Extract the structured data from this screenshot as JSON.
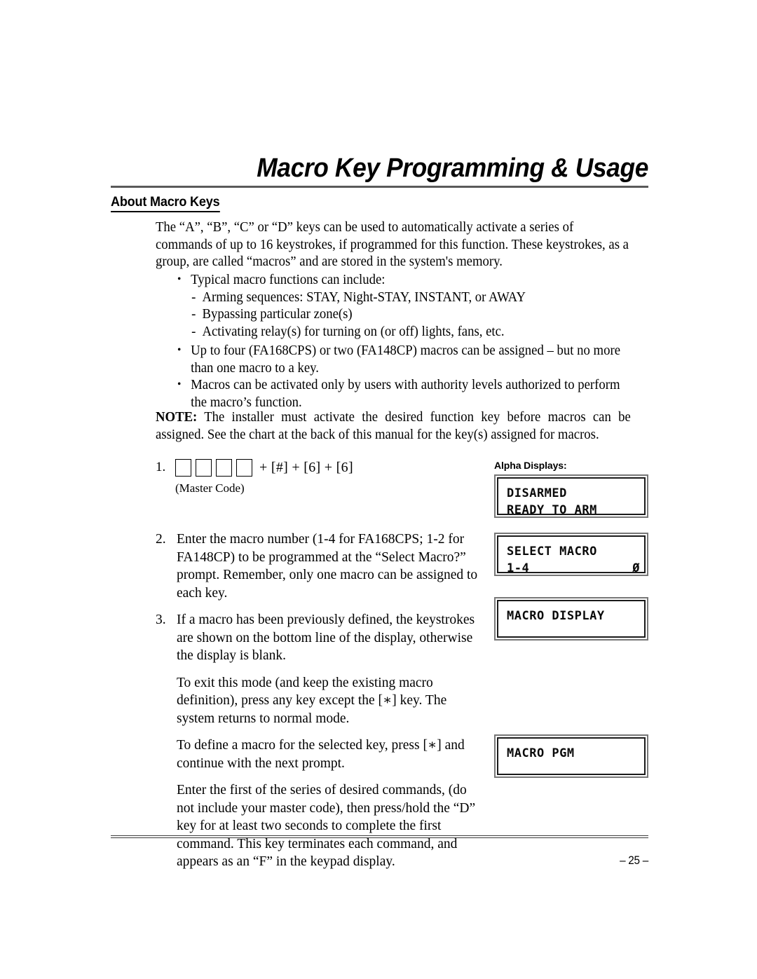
{
  "document": {
    "title": "Macro Key Programming & Usage",
    "section_heading": "About Macro Keys",
    "page_number": "– 25 –"
  },
  "intro": {
    "paragraph": "The “A”, “B”, “C” or “D” keys can be used to automatically activate a series of commands of up to 16 keystrokes, if programmed for this function. These keystrokes, as a group, are called “macros” and are stored in the system's memory."
  },
  "bullets": [
    {
      "type": "bullet",
      "text": "Typical macro functions can include:"
    },
    {
      "type": "dash",
      "text": "Arming sequences: STAY, Night-STAY, INSTANT, or AWAY"
    },
    {
      "type": "dash",
      "text": "Bypassing particular zone(s)"
    },
    {
      "type": "dash",
      "text": "Activating relay(s) for turning on (or off) lights, fans, etc."
    },
    {
      "type": "bullet",
      "text": "Up to four (FA168CPS) or two (FA148CP) macros can be assigned – but no more than one macro to a key."
    },
    {
      "type": "bullet",
      "text": "Macros can be activated only by users with authority levels authorized to perform the macro’s function."
    }
  ],
  "note": {
    "label": "NOTE:",
    "text": " The installer must activate the desired function key before macros can be assigned. See the chart at the back of this manual for the key(s) assigned for macros."
  },
  "step1": {
    "number": "1.",
    "box_count": 4,
    "keys": "+  [#] + [6] + [6]",
    "caption": "(Master Code)"
  },
  "steps": [
    {
      "number": "2.",
      "text": "Enter the macro number (1-4 for FA168CPS; 1-2 for FA148CP) to be programmed at the “Select Macro?” prompt. Remember, only one macro can be assigned to each key."
    },
    {
      "number": "3.",
      "text": "If a macro has been previously defined, the keystrokes are shown on the bottom line of the display, otherwise the display is blank."
    }
  ],
  "paragraphs": [
    "To exit this mode (and keep the existing macro definition), press any key except the [∗] key. The system returns to normal mode.",
    "To define a macro for the selected key, press [∗] and continue with the next prompt.",
    "Enter the first of the series of desired commands, (do not include your master code), then press/hold the “D” key for at least two seconds to complete the first command. This key terminates each command, and appears as an “F” in the keypad display."
  ],
  "alpha_displays": {
    "label": "Alpha Displays:",
    "screens": [
      {
        "id": "disarmed",
        "line1": "DISARMED",
        "line2": "READY TO ARM",
        "line2_right": ""
      },
      {
        "id": "select_macro",
        "line1": "SELECT MACRO",
        "line2": "1-4",
        "line2_right": "Ø"
      },
      {
        "id": "macro_display",
        "line1": "MACRO DISPLAY",
        "line2": "",
        "line2_right": ""
      },
      {
        "id": "macro_pgm",
        "line1": "MACRO PGM",
        "line2": "",
        "line2_right": ""
      }
    ]
  },
  "colors": {
    "text": "#000000",
    "rule": "#5a5a5a",
    "lcd_border_outer": "#777777",
    "lcd_border_inner": "#1a1a1a"
  }
}
